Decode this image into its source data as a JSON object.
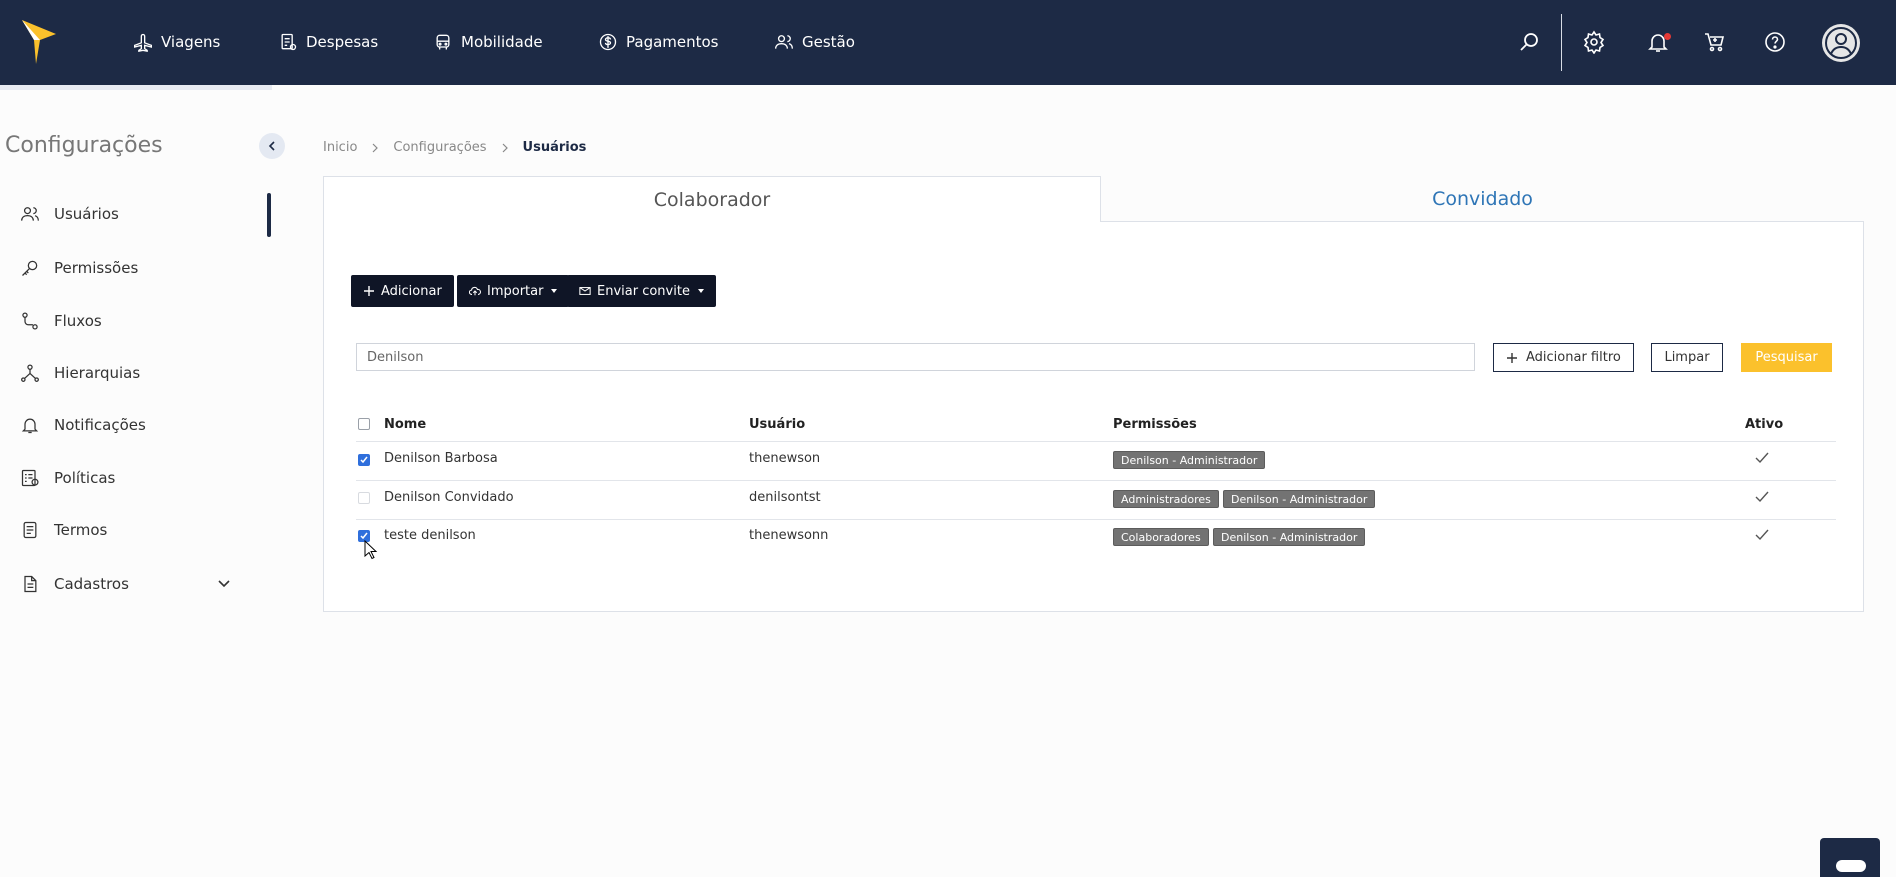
{
  "nav": {
    "items": [
      {
        "label": "Viagens",
        "icon": "plane-icon"
      },
      {
        "label": "Despesas",
        "icon": "receipt-icon"
      },
      {
        "label": "Mobilidade",
        "icon": "car-icon"
      },
      {
        "label": "Pagamentos",
        "icon": "dollar-icon"
      },
      {
        "label": "Gestão",
        "icon": "users-icon"
      }
    ]
  },
  "sidebar": {
    "title": "Configurações",
    "items": [
      {
        "label": "Usuários",
        "icon": "users-icon"
      },
      {
        "label": "Permissões",
        "icon": "key-icon"
      },
      {
        "label": "Fluxos",
        "icon": "flow-icon"
      },
      {
        "label": "Hierarquias",
        "icon": "hierarchy-icon"
      },
      {
        "label": "Notificações",
        "icon": "bell-icon"
      },
      {
        "label": "Políticas",
        "icon": "policy-icon"
      },
      {
        "label": "Termos",
        "icon": "document-icon"
      },
      {
        "label": "Cadastros",
        "icon": "file-icon"
      }
    ]
  },
  "breadcrumb": [
    "Inicio",
    "Configurações",
    "Usuários"
  ],
  "tabs": {
    "active": "Colaborador",
    "inactive": "Convidado"
  },
  "actions": {
    "add": "Adicionar",
    "import": "Importar",
    "invite": "Enviar convite"
  },
  "search": {
    "value": "Denilson",
    "add_filter": "Adicionar filtro",
    "clear": "Limpar",
    "search": "Pesquisar"
  },
  "table": {
    "headers": {
      "name": "Nome",
      "user": "Usuário",
      "perms": "Permissões",
      "active": "Ativo"
    },
    "rows": [
      {
        "name": "Denilson Barbosa",
        "user": "thenewson",
        "tags": [
          "Denilson - Administrador"
        ],
        "checked": true,
        "active": true
      },
      {
        "name": "Denilson Convidado",
        "user": "denilsontst",
        "tags": [
          "Administradores",
          "Denilson - Administrador"
        ],
        "checked": false,
        "active": true
      },
      {
        "name": "teste denilson",
        "user": "thenewsonn",
        "tags": [
          "Colaboradores",
          "Denilson - Administrador"
        ],
        "checked": true,
        "active": true
      }
    ]
  },
  "colors": {
    "nav_bg": "#1d2a45",
    "accent_yellow": "#fbc12c",
    "tab_link": "#2e75b6",
    "checkbox": "#2f6fdc"
  }
}
